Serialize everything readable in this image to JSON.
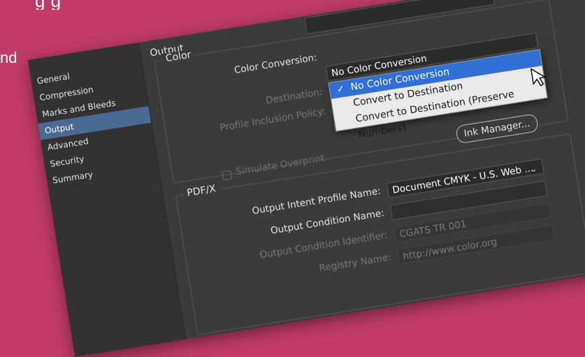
{
  "background": {
    "line1": "g g",
    "line2": "nd"
  },
  "sidebar": {
    "items": [
      {
        "label": "General"
      },
      {
        "label": "Compression"
      },
      {
        "label": "Marks and Bleeds"
      },
      {
        "label": "Output"
      },
      {
        "label": "Advanced"
      },
      {
        "label": "Security"
      },
      {
        "label": "Summary"
      }
    ],
    "active_index": 3
  },
  "main": {
    "heading": "Output",
    "color_group": {
      "legend": "Color",
      "color_conversion_label": "Color Conversion:",
      "color_conversion_value": "No Color Conversion",
      "destination_label": "Destination:",
      "profile_inclusion_label": "Profile Inclusion Policy:",
      "dropdown_options": [
        "No Color Conversion",
        "Convert to Destination",
        "Convert to Destination (Preserve Numbers)"
      ],
      "selected_option": "No Color Conversion",
      "simulate_overprint_label": "Simulate Overprint",
      "ink_manager_label": "Ink Manager..."
    },
    "pdfx_group": {
      "legend": "PDF/X",
      "output_intent_label": "Output Intent Profile Name:",
      "output_intent_value": "Document CMYK - U.S. Web ...",
      "output_condition_name_label": "Output Condition Name:",
      "output_condition_name_value": "",
      "output_condition_identifier_label": "Output Condition Identifier:",
      "output_condition_identifier_value": "CGATS TR 001",
      "registry_name_label": "Registry Name:",
      "registry_name_value": "http://www.color.org"
    }
  },
  "colors": {
    "background": "#c03c66",
    "dialog": "#3b3b3b",
    "sidebar_active": "#4b6a92",
    "dropdown_highlight": "#2f6fd6"
  },
  "icons": {
    "chevron": "chevron-down-icon",
    "check": "check-icon",
    "cursor": "mouse-pointer-icon"
  }
}
